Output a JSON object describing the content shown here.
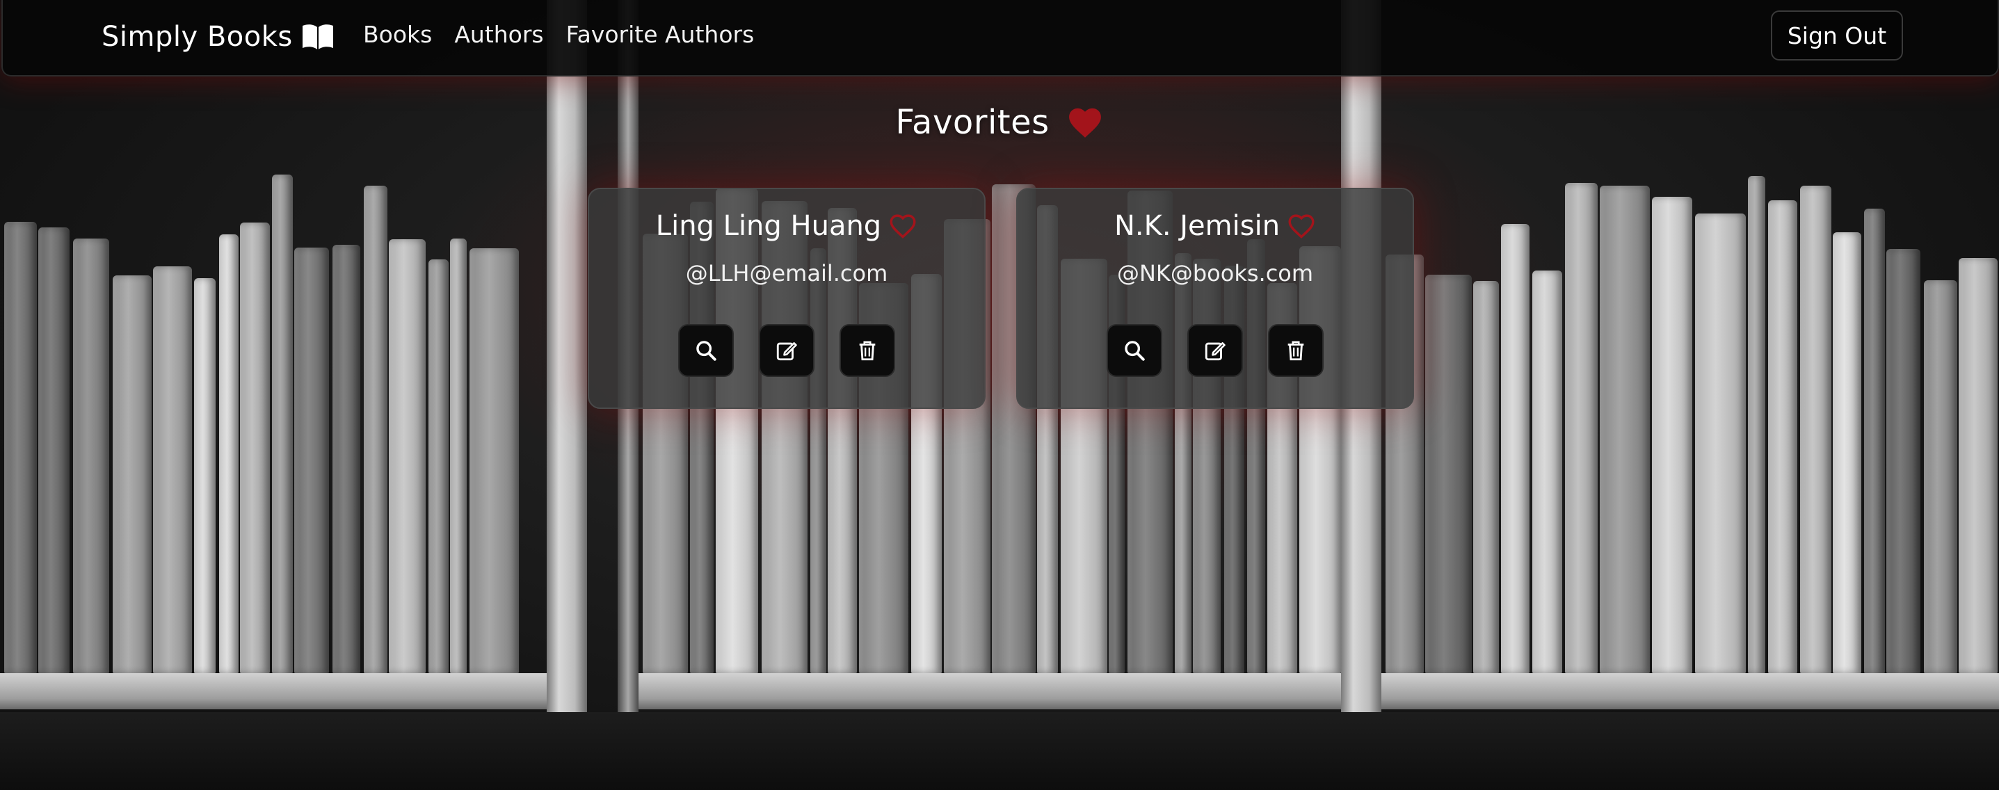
{
  "navbar": {
    "brand": "Simply Books",
    "brand_icon": "open-book-icon",
    "links": [
      "Books",
      "Authors",
      "Favorite Authors"
    ],
    "sign_out": "Sign Out"
  },
  "page": {
    "heading": "Favorites",
    "heading_icon": "heart-filled-icon"
  },
  "authors": [
    {
      "name": "Ling Ling Huang",
      "email": "@LLH@email.com",
      "favorite_icon": "heart-outline-icon"
    },
    {
      "name": "N.K. Jemisin",
      "email": "@NK@books.com",
      "favorite_icon": "heart-outline-icon"
    }
  ],
  "card_actions": [
    "search-icon",
    "edit-icon",
    "trash-icon"
  ],
  "colors": {
    "accent_red": "#a3141b",
    "navbar_bg": "#060606",
    "card_bg": "#3a3a3a",
    "button_bg": "#0c0c0c",
    "text": "#ffffff"
  }
}
